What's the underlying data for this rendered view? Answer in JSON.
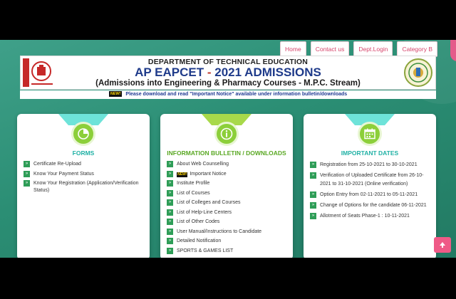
{
  "nav": {
    "items": [
      {
        "label": "Home"
      },
      {
        "label": "Contact us"
      },
      {
        "label": "Dept.Login"
      },
      {
        "label": "Category B"
      }
    ]
  },
  "header": {
    "department": "DEPARTMENT OF TECHNICAL EDUCATION",
    "title_part1": "AP EAPCET",
    "title_dash": "-",
    "title_part2": "2021 ADMISSIONS",
    "subtitle": "(Admissions into Engineering & Pharmacy Courses - M.P.C. Stream)"
  },
  "notice": {
    "badge": "NEW!",
    "text": "Please download and read \"Important Notice\" available under information bulletin/downloads"
  },
  "cards": {
    "forms": {
      "title": "FORMS",
      "icon": "pie-chart-icon",
      "items": [
        {
          "label": "Certificate Re-Upload"
        },
        {
          "label": "Know Your Payment Status"
        },
        {
          "label": "Know Your Registration (Application/Verification Status)"
        }
      ]
    },
    "bulletin": {
      "title": "INFORMATION BULLETIN / DOWNLOADS",
      "icon": "info-icon",
      "items": [
        {
          "label": "About Web Counselling"
        },
        {
          "label": "Important Notice",
          "badge": "NEW!"
        },
        {
          "label": "Institute Profile"
        },
        {
          "label": "List of Courses"
        },
        {
          "label": "List of Colleges and Courses"
        },
        {
          "label": "List of Help-Line Centers"
        },
        {
          "label": "List of Other Codes"
        },
        {
          "label": "User Manual/Instructions to Candidate"
        },
        {
          "label": "Detailed Notification"
        },
        {
          "label": "SPORTS & GAMES LIST"
        }
      ]
    },
    "dates": {
      "title": "IMPORTANT DATES",
      "icon": "calendar-icon",
      "items": [
        {
          "label": "Registration from 25-10-2021 to 30-10-2021"
        },
        {
          "label": "Verification of Uploaded Certificate from 26-10-2021 to 31-10-2021 (Online verification)"
        },
        {
          "label": "Option Entry from 02-11-2021 to 05-11-2021"
        },
        {
          "label": "Change of Options for the candidate 06-11-2021"
        },
        {
          "label": "Allotment of Seats Phase-1 : 10-11-2021"
        }
      ]
    }
  },
  "colors": {
    "background": "#2b8e74",
    "accent": "#d6446b",
    "title_blue": "#1e3a8a",
    "icon_green": "#8ccf3a",
    "bullet_green": "#2e9d57"
  },
  "scroll_top": {
    "icon": "arrow-up-icon"
  }
}
